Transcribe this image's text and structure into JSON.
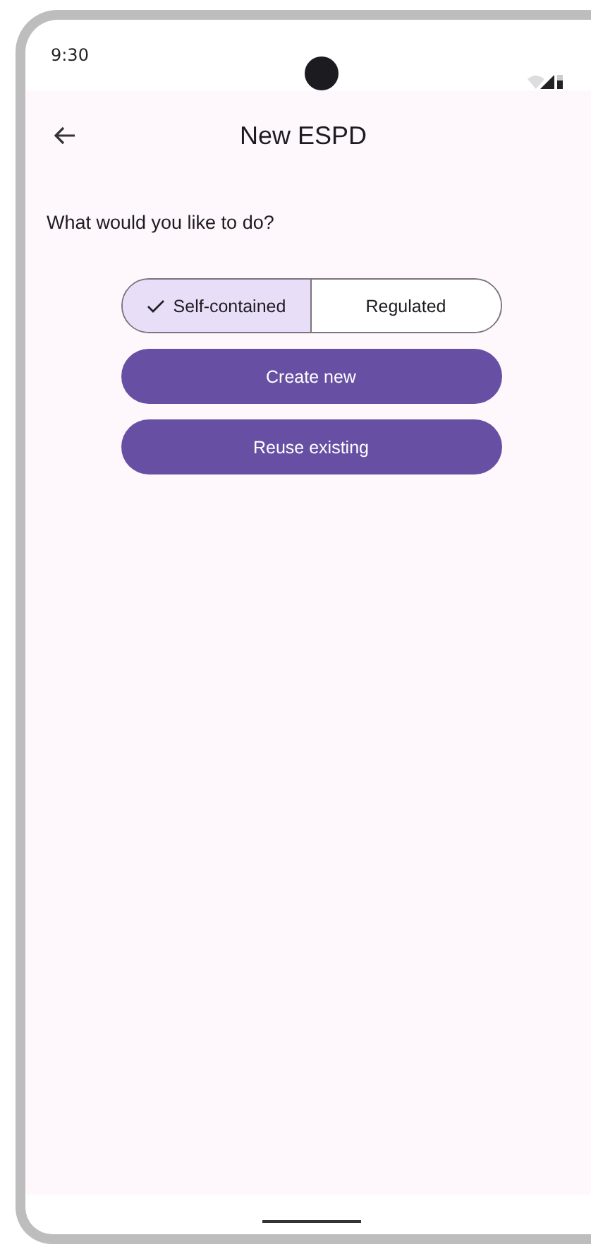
{
  "status_bar": {
    "time": "9:30"
  },
  "top_bar": {
    "title": "New ESPD"
  },
  "prompt": "What would you like to do?",
  "segments": [
    {
      "label": "Self-contained",
      "selected": true
    },
    {
      "label": "Regulated",
      "selected": false
    }
  ],
  "buttons": [
    "Create new",
    "Reuse existing"
  ]
}
